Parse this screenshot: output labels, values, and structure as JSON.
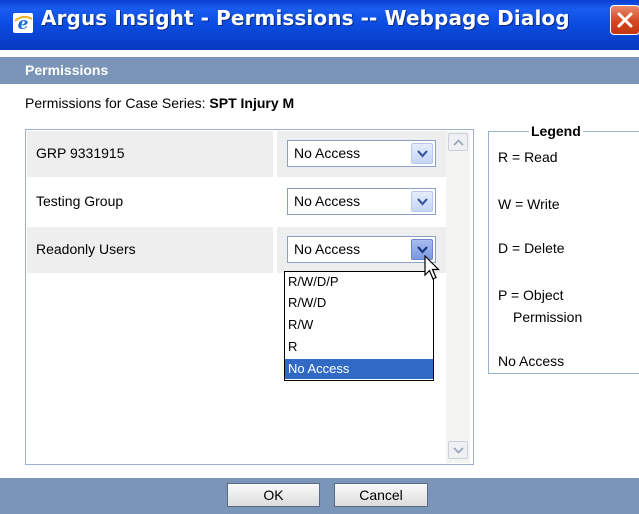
{
  "window": {
    "title": "Argus Insight - Permissions -- Webpage Dialog"
  },
  "header": {
    "label": "Permissions"
  },
  "series": {
    "prefix": "Permissions for Case Series:",
    "name": "SPT Injury M"
  },
  "groups": [
    {
      "name": "GRP 9331915",
      "permission": "No Access"
    },
    {
      "name": "Testing Group",
      "permission": "No Access"
    },
    {
      "name": "Readonly Users",
      "permission": "No Access"
    }
  ],
  "dropdown": {
    "options": [
      "R/W/D/P",
      "R/W/D",
      "R/W",
      "R",
      "No Access"
    ],
    "selected": "No Access"
  },
  "legend": {
    "title": "Legend",
    "items": [
      "R = Read",
      "W = Write",
      "D = Delete",
      "P = Object",
      "Permission",
      "No Access"
    ]
  },
  "footer": {
    "ok_label": "OK",
    "cancel_label": "Cancel"
  },
  "colors": {
    "titlebar": "#0a4ce0",
    "band": "#7a95b8",
    "selection": "#316ac5"
  }
}
